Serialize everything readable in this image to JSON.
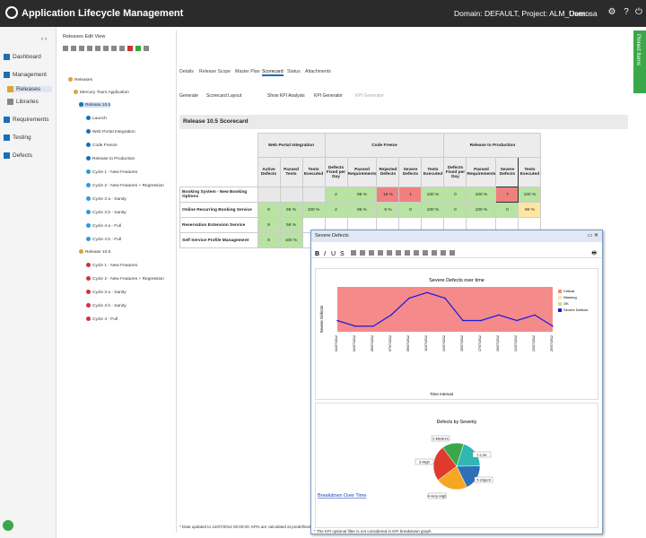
{
  "app": {
    "title": "Application Lifecycle Management",
    "domain_project": "Domain: DEFAULT, Project: ALM_Demo",
    "user": "User: sa"
  },
  "leftnav": {
    "items": [
      {
        "label": "Dashboard"
      },
      {
        "label": "Management"
      },
      {
        "label": "Releases"
      },
      {
        "label": "Libraries"
      },
      {
        "label": "Requirements"
      },
      {
        "label": "Testing"
      },
      {
        "label": "Defects"
      }
    ]
  },
  "tree": {
    "menu": "Releases  Edit  View",
    "nodes": [
      "Releases",
      "Mercury Tours Application",
      "Release 10.5",
      "Launch",
      "Web Portal Integration",
      "Code Freeze",
      "Release to Production",
      "Cycle 1 - New Features",
      "Cycle 2 - New Features + Regression",
      "Cycle 3 a - Sanity",
      "Cycle 3 b - Sanity",
      "Cycle 4 a - Full",
      "Cycle 4 b - Full",
      "Release 10.6",
      "Cycle 1 - New Features",
      "Cycle 2 - New Features + Regression",
      "Cycle 3 a - Sanity",
      "Cycle 3 b - Sanity",
      "Cycle 4 - Full"
    ]
  },
  "rightbar": {
    "label": "Pinned Items"
  },
  "tabs": [
    "Details",
    "Release Scope",
    "Master Plan",
    "Scorecard",
    "Status",
    "Attachments"
  ],
  "toolbar": [
    "Generate",
    "Scorecard Layout",
    "Show KPI Analysis",
    "KPI Generator",
    "KPI Generator"
  ],
  "scorecard": {
    "title": "Release 10.5 Scorecard",
    "groups": [
      "Web Portal Integration",
      "Code Freeze",
      "Release to Production"
    ],
    "headers": [
      "Active Defects",
      "Passed Tests",
      "Tests Executed",
      "Defects Fixed per Day",
      "Passed Requirements",
      "Rejected Defects",
      "Severe Defects",
      "Tests Executed",
      "Defects Fixed per Day",
      "Passed Requirements",
      "Severe Defects",
      "Tests Executed"
    ],
    "rows": [
      {
        "label": "Booking System - New Booking Options",
        "cells": [
          "",
          "",
          "",
          "2",
          "95 %",
          "18 %",
          "1",
          "100 %",
          "0",
          "100 %",
          "7",
          "100 %"
        ]
      },
      {
        "label": "Online Recurring Booking Service",
        "cells": [
          "9",
          "95 %",
          "100 %",
          "2",
          "95 %",
          "5 %",
          "0",
          "100 %",
          "0",
          "100 %",
          "0",
          "80 %"
        ]
      },
      {
        "label": "Reservation Extension Service",
        "cells": [
          "9",
          "58 %",
          "",
          "",
          "",
          "",
          "",
          "",
          "",
          "",
          "",
          ""
        ]
      },
      {
        "label": "Self Service Profile Management",
        "cells": [
          "9",
          "100 %",
          "",
          "",
          "",
          "",
          "",
          "",
          "",
          "",
          "",
          ""
        ]
      }
    ],
    "note": "* Data updated to 12/07/2012 00:00:00. KPIs are calculated at predefined hours"
  },
  "severe_window": {
    "title": "Severe Defects",
    "line_chart_title": "Severe Defects over time",
    "ylabel": "Severe Defects",
    "xlabel": "Time Interval",
    "legend": [
      "Critical",
      "Warning",
      "OK",
      "Severe Defects"
    ],
    "pie_title": "Defects by Severity",
    "breakdown_link": "Breakdown Over Time",
    "note": "* The KPI optional filter is not considered in KPI breakdown graph"
  },
  "chart_data": [
    {
      "type": "area",
      "title": "Severe Defects over time",
      "xlabel": "Time Interval",
      "ylabel": "Severe Defects",
      "x": [
        "01/07/2012",
        "03/07/2012",
        "05/07/2012",
        "07/07/2012",
        "09/07/2012",
        "11/07/2012",
        "13/07/2012",
        "15/07/2012",
        "17/07/2012",
        "19/07/2012",
        "21/07/2012",
        "23/07/2012",
        "25/07/2012"
      ],
      "series": [
        {
          "name": "Severe Defects",
          "values": [
            2,
            1,
            1,
            3,
            6,
            7,
            6,
            2,
            2,
            3,
            2,
            3,
            1
          ]
        }
      ],
      "bands": [
        "Critical",
        "Warning",
        "OK"
      ]
    },
    {
      "type": "pie",
      "title": "Defects by Severity",
      "categories": [
        "2-Medium",
        "3-High",
        "4-Very High",
        "5-Urgent",
        "1-Low"
      ],
      "values": [
        20,
        18,
        22,
        25,
        15
      ],
      "colors": [
        "#2fb7b2",
        "#2f6fb7",
        "#f5a623",
        "#e03a2f",
        "#3aa84a"
      ]
    }
  ]
}
